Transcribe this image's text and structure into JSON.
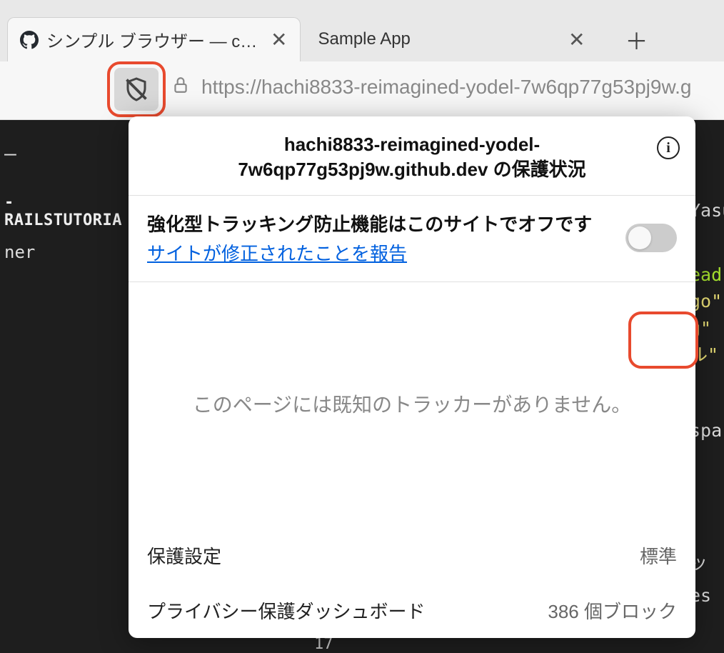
{
  "tabs": {
    "active": {
      "label": "シンプル ブラウザー — codespac"
    },
    "inactive": {
      "label": "Sample App"
    }
  },
  "url": "https://hachi8833-reimagined-yodel-7w6qp77g53pj9w.g",
  "editor": {
    "folder": "-RAILSTUTORIA",
    "item": "ner",
    "bottom": "17",
    "tokens": {
      "yasu": "Yasu",
      "t1": "ead",
      "t2": "go\"",
      "t3": "g\"",
      "t4": "ル\"",
      "t5": "spa",
      "t6": "ッ",
      "t7": "es"
    },
    "minus": "—"
  },
  "popup": {
    "title": "hachi8833-reimagined-yodel-7w6qp77g53pj9w.github.dev の保護状況",
    "tracking_heading": "強化型トラッキング防止機能はこのサイトでオフです",
    "report_link": "サイトが修正されたことを報告",
    "no_trackers": "このページには既知のトラッカーがありません。",
    "settings_label": "保護設定",
    "settings_value": "標準",
    "dashboard_label": "プライバシー保護ダッシュボード",
    "dashboard_value": "386 個ブロック",
    "info_icon_label": "i"
  }
}
